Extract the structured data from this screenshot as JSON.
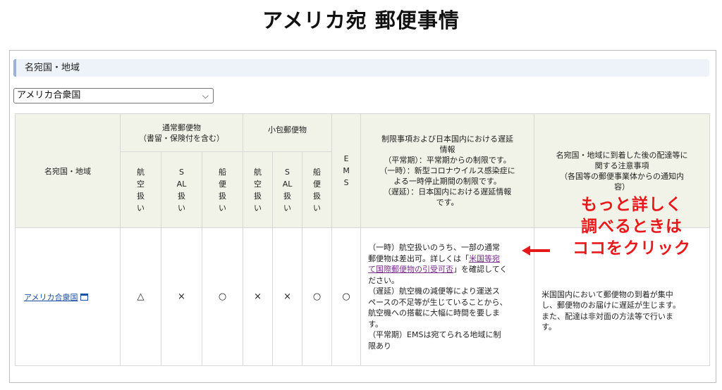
{
  "page": {
    "title": "アメリカ宛 郵便事情"
  },
  "section": {
    "label": "名宛国・地域"
  },
  "selector": {
    "value": "アメリカ合衆国"
  },
  "table": {
    "headers": {
      "destination": "名宛国・地域",
      "ordinary_group": "通常郵便物",
      "ordinary_sub": "（書留・保険付を含む）",
      "parcel_group": "小包郵便物",
      "air": "航空扱い",
      "sal": "SAL扱い",
      "ship": "船便扱い",
      "ems": "EMS",
      "restrictions": [
        "制限事項および日本国内における遅延",
        "情報",
        "（平常期）：平常期からの制限です。",
        "（一時）：新型コロナウイルス感染症に",
        "よる一時停止期間の制限です。",
        "（遅延）：日本国内における遅延情報",
        "です。"
      ],
      "notes": [
        "名宛国・地域に到着した後の配達等に",
        "関する注意事項",
        "（各国等の郵便事業体からの通知内",
        "容）"
      ]
    },
    "row": {
      "country": "アメリカ合衆国",
      "ordinary_air": "△",
      "ordinary_sal": "×",
      "ordinary_ship": "○",
      "parcel_air": "×",
      "parcel_sal": "×",
      "parcel_ship": "○",
      "ems": "○",
      "restriction": {
        "l1": "（一時）航空扱いのうち、一部の通常",
        "l2": "郵便物は差出可。詳しくは「",
        "link1": "米国等宛",
        "link2": "て国際郵便物の引受可否",
        "l3": "」を確認してく",
        "l4": "ださい。",
        "l5": "（遅延）航空機の減便等により運送ス",
        "l6": "ペースの不足等が生じていることから、",
        "l7": "航空機への搭載に大幅に時間を要しま",
        "l8": "す。",
        "l9": "（平常期）EMSは宛てられる地域に制",
        "l10": "限あり"
      },
      "notes": [
        "米国国内において郵便物の到着が集中",
        "し、郵便物のお届けに遅延が生じます。",
        "また、配達は非対面の方法等で行いま",
        "す。"
      ]
    }
  },
  "callout": {
    "lines": [
      "もっと詳しく",
      "調べるときは",
      "ココをクリック"
    ],
    "color": "#e8191b"
  }
}
